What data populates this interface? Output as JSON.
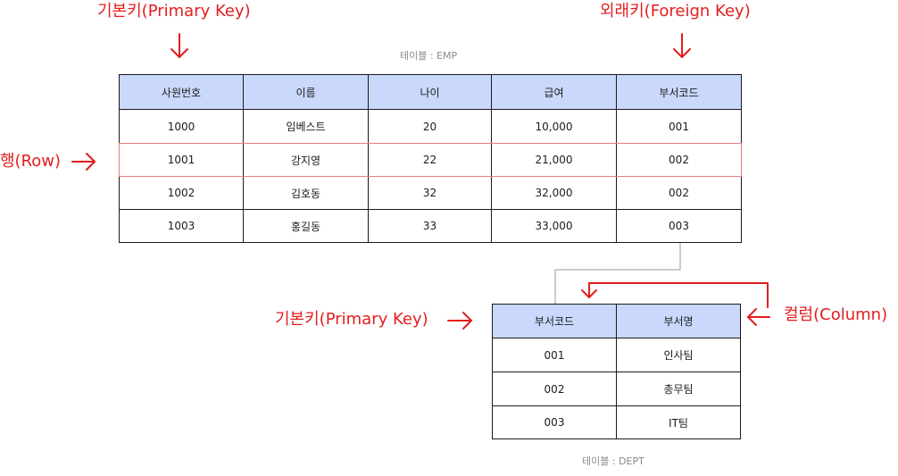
{
  "annotations": {
    "primary_key_top": "기본키(Primary Key)",
    "foreign_key": "외래키(Foreign Key)",
    "row": "행(Row)",
    "primary_key_bottom": "기본키(Primary Key)",
    "column": "컬럼(Column)"
  },
  "emp": {
    "caption": "테이블 : EMP",
    "headers": [
      "사원번호",
      "이름",
      "나이",
      "급여",
      "부서코드"
    ],
    "rows": [
      [
        "1000",
        "임베스트",
        "20",
        "10,000",
        "001"
      ],
      [
        "1001",
        "강지영",
        "22",
        "21,000",
        "002"
      ],
      [
        "1002",
        "김호동",
        "32",
        "32,000",
        "002"
      ],
      [
        "1003",
        "홍길동",
        "33",
        "33,000",
        "003"
      ]
    ]
  },
  "dept": {
    "caption": "테이블 : DEPT",
    "headers": [
      "부서코드",
      "부서명"
    ],
    "rows": [
      [
        "001",
        "인사팀"
      ],
      [
        "002",
        "총무팀"
      ],
      [
        "003",
        "IT팀"
      ]
    ]
  },
  "colors": {
    "annotation": "#e31d1d",
    "header_fill": "#c9d8fb",
    "row_highlight": "#f07b7b",
    "connector": "#9a9a9a"
  }
}
